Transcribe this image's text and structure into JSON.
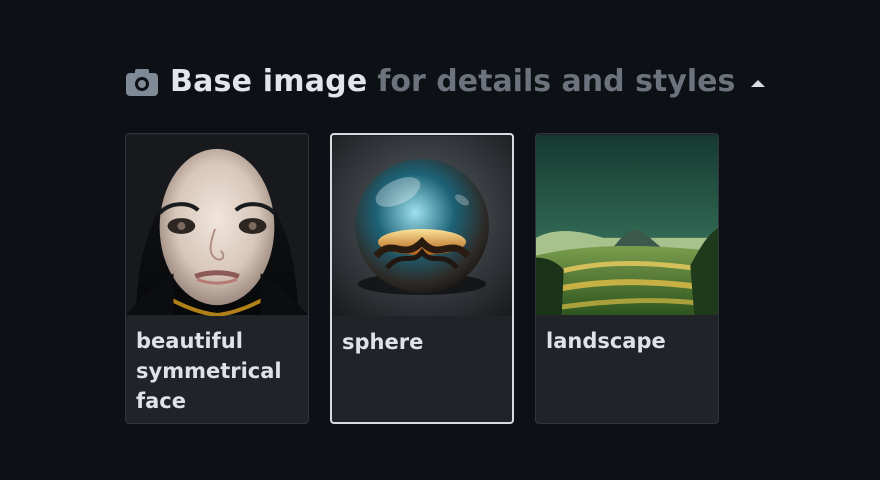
{
  "header": {
    "title": "Base image",
    "subtitle": "for details and styles"
  },
  "icons": {
    "camera": "camera-icon",
    "caret": "caret-up-icon"
  },
  "cards": [
    {
      "label": "beautiful symmetrical face",
      "selected": false,
      "thumbnail": "portrait-icon"
    },
    {
      "label": "sphere",
      "selected": true,
      "thumbnail": "glass-sphere-icon"
    },
    {
      "label": "landscape",
      "selected": false,
      "thumbnail": "green-landscape-icon"
    }
  ],
  "colors": {
    "background": "#0d1014",
    "card_background": "#202328",
    "selected_border": "#d7dadf"
  }
}
